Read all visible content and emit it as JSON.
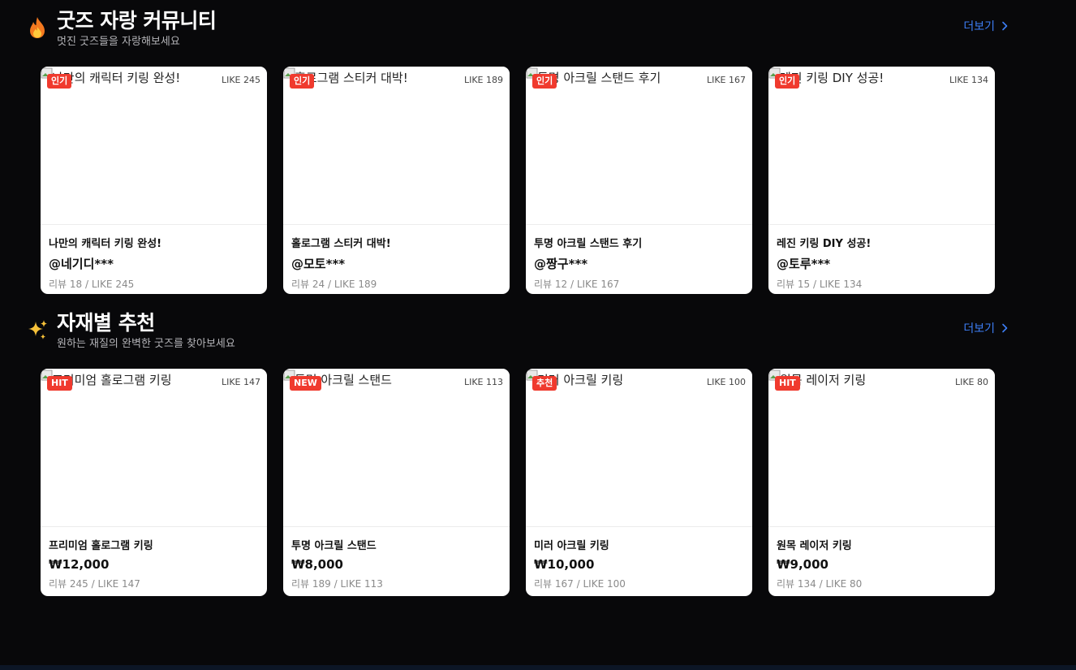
{
  "community": {
    "icon": "fire-icon",
    "title": "굿즈 자랑 커뮤니티",
    "subtitle": "멋진 굿즈들을 자랑해보세요",
    "more_label": "더보기",
    "cards": [
      {
        "alt": "나만의 캐릭터 키링 완성!",
        "badge": "인기",
        "like": "LIKE 245",
        "title": "나만의 캐릭터 키링 완성!",
        "sub": "@네기디***",
        "meta": "리뷰 18 / LIKE 245"
      },
      {
        "alt": "홀로그램 스티커 대박!",
        "badge": "인기",
        "like": "LIKE 189",
        "title": "홀로그램 스티커 대박!",
        "sub": "@모토***",
        "meta": "리뷰 24 / LIKE 189"
      },
      {
        "alt": "투명 아크릴 스탠드 후기",
        "badge": "인기",
        "like": "LIKE 167",
        "title": "투명 아크릴 스탠드 후기",
        "sub": "@짱구***",
        "meta": "리뷰 12 / LIKE 167"
      },
      {
        "alt": "레진 키링 DIY 성공!",
        "badge": "인기",
        "like": "LIKE 134",
        "title": "레진 키링 DIY 성공!",
        "sub": "@토루***",
        "meta": "리뷰 15 / LIKE 134"
      }
    ]
  },
  "materials": {
    "icon": "sparkles-icon",
    "title": "자재별 추천",
    "subtitle": "원하는 재질의 완벽한 굿즈를 찾아보세요",
    "more_label": "더보기",
    "cards": [
      {
        "alt": "프리미엄 홀로그램 키링",
        "badge": "HIT",
        "like": "LIKE 147",
        "title": "프리미엄 홀로그램 키링",
        "sub": "₩12,000",
        "meta": "리뷰 245 / LIKE 147"
      },
      {
        "alt": "투명 아크릴 스탠드",
        "badge": "NEW",
        "like": "LIKE 113",
        "title": "투명 아크릴 스탠드",
        "sub": "₩8,000",
        "meta": "리뷰 189 / LIKE 113"
      },
      {
        "alt": "미러 아크릴 키링",
        "badge": "추천",
        "like": "LIKE 100",
        "title": "미러 아크릴 키링",
        "sub": "₩10,000",
        "meta": "리뷰 167 / LIKE 100"
      },
      {
        "alt": "원목 레이저 키링",
        "badge": "HIT",
        "like": "LIKE 80",
        "title": "원목 레이저 키링",
        "sub": "₩9,000",
        "meta": "리뷰 134 / LIKE 80"
      }
    ]
  },
  "colors": {
    "background": "#08080a",
    "link": "#3d7ef5",
    "badge": "#f03a2e",
    "card": "#ffffff"
  }
}
